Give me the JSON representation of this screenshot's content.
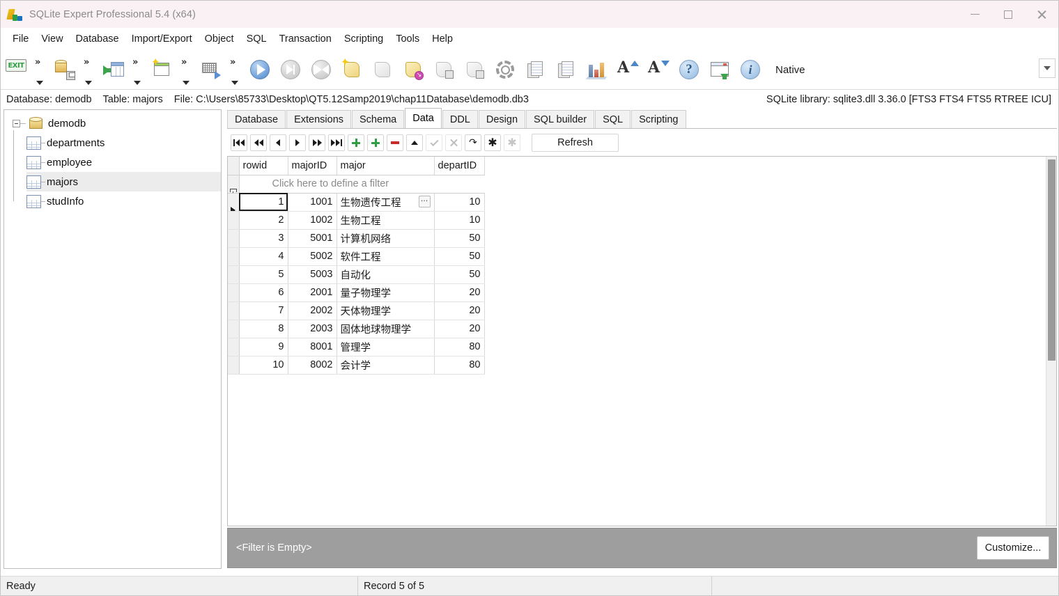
{
  "window": {
    "title": "SQLite Expert Professional 5.4 (x64)",
    "app_icon": "sqlite-expert-icon",
    "minimize": "minimize-icon",
    "maximize": "maximize-icon",
    "close": "close-icon"
  },
  "menubar": {
    "items": [
      {
        "label": "File"
      },
      {
        "label": "View"
      },
      {
        "label": "Database"
      },
      {
        "label": "Import/Export"
      },
      {
        "label": "Object"
      },
      {
        "label": "SQL"
      },
      {
        "label": "Transaction"
      },
      {
        "label": "Scripting"
      },
      {
        "label": "Tools"
      },
      {
        "label": "Help"
      }
    ]
  },
  "toolbar": {
    "native_label": "Native",
    "overflow_icon": "toolbar-overflow-chevron-icon",
    "buttons": [
      {
        "name": "exit-button",
        "icon": "exit-icon"
      },
      {
        "name": "backup-database-button",
        "icon": "database-save-icon"
      },
      {
        "name": "import-table-button",
        "icon": "table-import-icon"
      },
      {
        "name": "new-window-button",
        "icon": "new-window-icon"
      },
      {
        "name": "design-query-button",
        "icon": "query-design-icon"
      },
      {
        "name": "execute-button",
        "icon": "play-icon"
      },
      {
        "name": "execute-step-button",
        "icon": "step-forward-icon"
      },
      {
        "name": "execute-back-button",
        "icon": "step-back-icon"
      },
      {
        "name": "new-script-button",
        "icon": "script-new-icon"
      },
      {
        "name": "run-script-button",
        "icon": "script-run-icon"
      },
      {
        "name": "script-download-button",
        "icon": "script-download-icon"
      },
      {
        "name": "save-script-button",
        "icon": "script-save-icon"
      },
      {
        "name": "save-script-as-button",
        "icon": "script-save-as-icon"
      },
      {
        "name": "options-button",
        "icon": "gear-icon"
      },
      {
        "name": "copy-button",
        "icon": "copy-documents-icon"
      },
      {
        "name": "paste-button",
        "icon": "paste-documents-icon"
      },
      {
        "name": "chart-button",
        "icon": "bar-chart-icon"
      },
      {
        "name": "increase-font-button",
        "icon": "font-increase-icon"
      },
      {
        "name": "decrease-font-button",
        "icon": "font-decrease-icon"
      },
      {
        "name": "help-button",
        "icon": "question-mark-icon"
      },
      {
        "name": "import-window-button",
        "icon": "window-download-icon"
      },
      {
        "name": "about-button",
        "icon": "info-icon"
      }
    ]
  },
  "infobar": {
    "database_label": "Database: demodb",
    "table_label": "Table: majors",
    "file_label": "File: C:\\Users\\85733\\Desktop\\QT5.12Samp2019\\chap11Database\\demodb.db3",
    "library_label": "SQLite library: sqlite3.dll 3.36.0 [FTS3 FTS4 FTS5 RTREE ICU]"
  },
  "sidebar": {
    "root": {
      "label": "demodb",
      "icon": "database-icon",
      "expander": "collapse-icon"
    },
    "tables": [
      {
        "label": "departments",
        "icon": "table-icon",
        "selected": false
      },
      {
        "label": "employee",
        "icon": "table-icon",
        "selected": false
      },
      {
        "label": "majors",
        "icon": "table-icon",
        "selected": true
      },
      {
        "label": "studInfo",
        "icon": "table-icon",
        "selected": false
      }
    ]
  },
  "tabs": [
    {
      "label": "Database",
      "active": false
    },
    {
      "label": "Extensions",
      "active": false
    },
    {
      "label": "Schema",
      "active": false
    },
    {
      "label": "Data",
      "active": true
    },
    {
      "label": "DDL",
      "active": false
    },
    {
      "label": "Design",
      "active": false
    },
    {
      "label": "SQL builder",
      "active": false
    },
    {
      "label": "SQL",
      "active": false
    },
    {
      "label": "Scripting",
      "active": false
    }
  ],
  "grid_toolbar": {
    "refresh_label": "Refresh",
    "buttons": [
      {
        "name": "first-record-button",
        "icon": "first-record-icon",
        "disabled": false
      },
      {
        "name": "prior-page-button",
        "icon": "prior-page-icon",
        "disabled": false
      },
      {
        "name": "prior-record-button",
        "icon": "prior-record-icon",
        "disabled": false
      },
      {
        "name": "next-record-button",
        "icon": "next-record-icon",
        "disabled": false
      },
      {
        "name": "next-page-button",
        "icon": "next-page-icon",
        "disabled": false
      },
      {
        "name": "last-record-button",
        "icon": "last-record-icon",
        "disabled": false
      },
      {
        "name": "insert-record-button",
        "icon": "plus-icon",
        "disabled": false
      },
      {
        "name": "duplicate-record-button",
        "icon": "plus-copy-icon",
        "disabled": false
      },
      {
        "name": "delete-record-button",
        "icon": "minus-icon",
        "disabled": false
      },
      {
        "name": "post-edit-button",
        "icon": "triangle-up-icon",
        "disabled": false
      },
      {
        "name": "commit-button",
        "icon": "check-icon",
        "disabled": true
      },
      {
        "name": "cancel-button",
        "icon": "cross-icon",
        "disabled": true
      },
      {
        "name": "refresh-record-button",
        "icon": "redo-arrow-icon",
        "disabled": false
      },
      {
        "name": "set-null-button",
        "icon": "asterisk-icon",
        "disabled": false
      },
      {
        "name": "clear-null-button",
        "icon": "asterisk-dim-icon",
        "disabled": true
      }
    ]
  },
  "grid": {
    "filter_row_placeholder": "Click here to define a filter",
    "filter_icon": "filter-funnel-icon",
    "row_marker_icon": "current-row-arrow-icon",
    "ellipsis_label": "···",
    "columns": [
      "rowid",
      "majorID",
      "major",
      "departID"
    ],
    "rows": [
      {
        "rowid": "1",
        "majorID": "1001",
        "major": "生物遗传工程",
        "departID": "10"
      },
      {
        "rowid": "2",
        "majorID": "1002",
        "major": "生物工程",
        "departID": "10"
      },
      {
        "rowid": "3",
        "majorID": "5001",
        "major": "计算机网络",
        "departID": "50"
      },
      {
        "rowid": "4",
        "majorID": "5002",
        "major": "软件工程",
        "departID": "50"
      },
      {
        "rowid": "5",
        "majorID": "5003",
        "major": "自动化",
        "departID": "50"
      },
      {
        "rowid": "6",
        "majorID": "2001",
        "major": "量子物理学",
        "departID": "20"
      },
      {
        "rowid": "7",
        "majorID": "2002",
        "major": "天体物理学",
        "departID": "20"
      },
      {
        "rowid": "8",
        "majorID": "2003",
        "major": "固体地球物理学",
        "departID": "20"
      },
      {
        "rowid": "9",
        "majorID": "8001",
        "major": "管理学",
        "departID": "80"
      },
      {
        "rowid": "10",
        "majorID": "8002",
        "major": "会计学",
        "departID": "80"
      }
    ]
  },
  "filterbar": {
    "text": "<Filter is Empty>",
    "customize_label": "Customize..."
  },
  "statusbar": {
    "left": "Ready",
    "middle": "Record 5 of 5",
    "right": ""
  },
  "colors": {
    "titlebar_bg": "#faf1f5",
    "selection_bg": "#ececec",
    "filterbar_bg": "#9e9e9e",
    "accent_green": "#2f9e44",
    "accent_red": "#c92a2a",
    "accent_blue": "#5b8fd4"
  }
}
